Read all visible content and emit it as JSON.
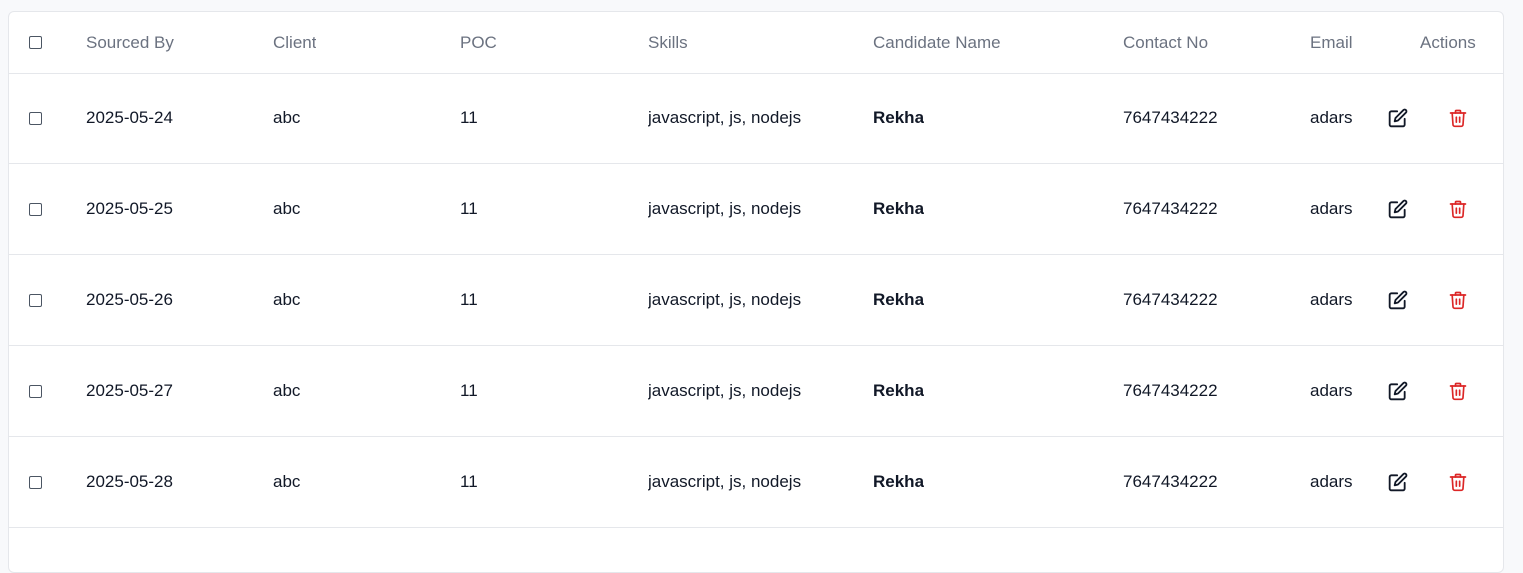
{
  "table": {
    "headers": {
      "sourced_by": "Sourced By",
      "client": "Client",
      "poc": "POC",
      "skills": "Skills",
      "candidate_name": "Candidate Name",
      "contact_no": "Contact No",
      "email": "Email",
      "actions": "Actions"
    },
    "rows": [
      {
        "sourced_by": "2025-05-24",
        "client": "abc",
        "poc": "11",
        "skills": "javascript, js, nodejs",
        "candidate_name": "Rekha",
        "contact_no": "7647434222",
        "email": "adars"
      },
      {
        "sourced_by": "2025-05-25",
        "client": "abc",
        "poc": "11",
        "skills": "javascript, js, nodejs",
        "candidate_name": "Rekha",
        "contact_no": "7647434222",
        "email": "adars"
      },
      {
        "sourced_by": "2025-05-26",
        "client": "abc",
        "poc": "11",
        "skills": "javascript, js, nodejs",
        "candidate_name": "Rekha",
        "contact_no": "7647434222",
        "email": "adars"
      },
      {
        "sourced_by": "2025-05-27",
        "client": "abc",
        "poc": "11",
        "skills": "javascript, js, nodejs",
        "candidate_name": "Rekha",
        "contact_no": "7647434222",
        "email": "adars"
      },
      {
        "sourced_by": "2025-05-28",
        "client": "abc",
        "poc": "11",
        "skills": "javascript, js, nodejs",
        "candidate_name": "Rekha",
        "contact_no": "7647434222",
        "email": "adars"
      }
    ],
    "icons": {
      "select_all": "checkbox-icon",
      "row_select": "checkbox-icon",
      "edit": "edit-icon",
      "delete": "trash-icon"
    },
    "colors": {
      "header_text": "#6b7280",
      "delete": "#dc2626",
      "edit": "#111827"
    }
  }
}
